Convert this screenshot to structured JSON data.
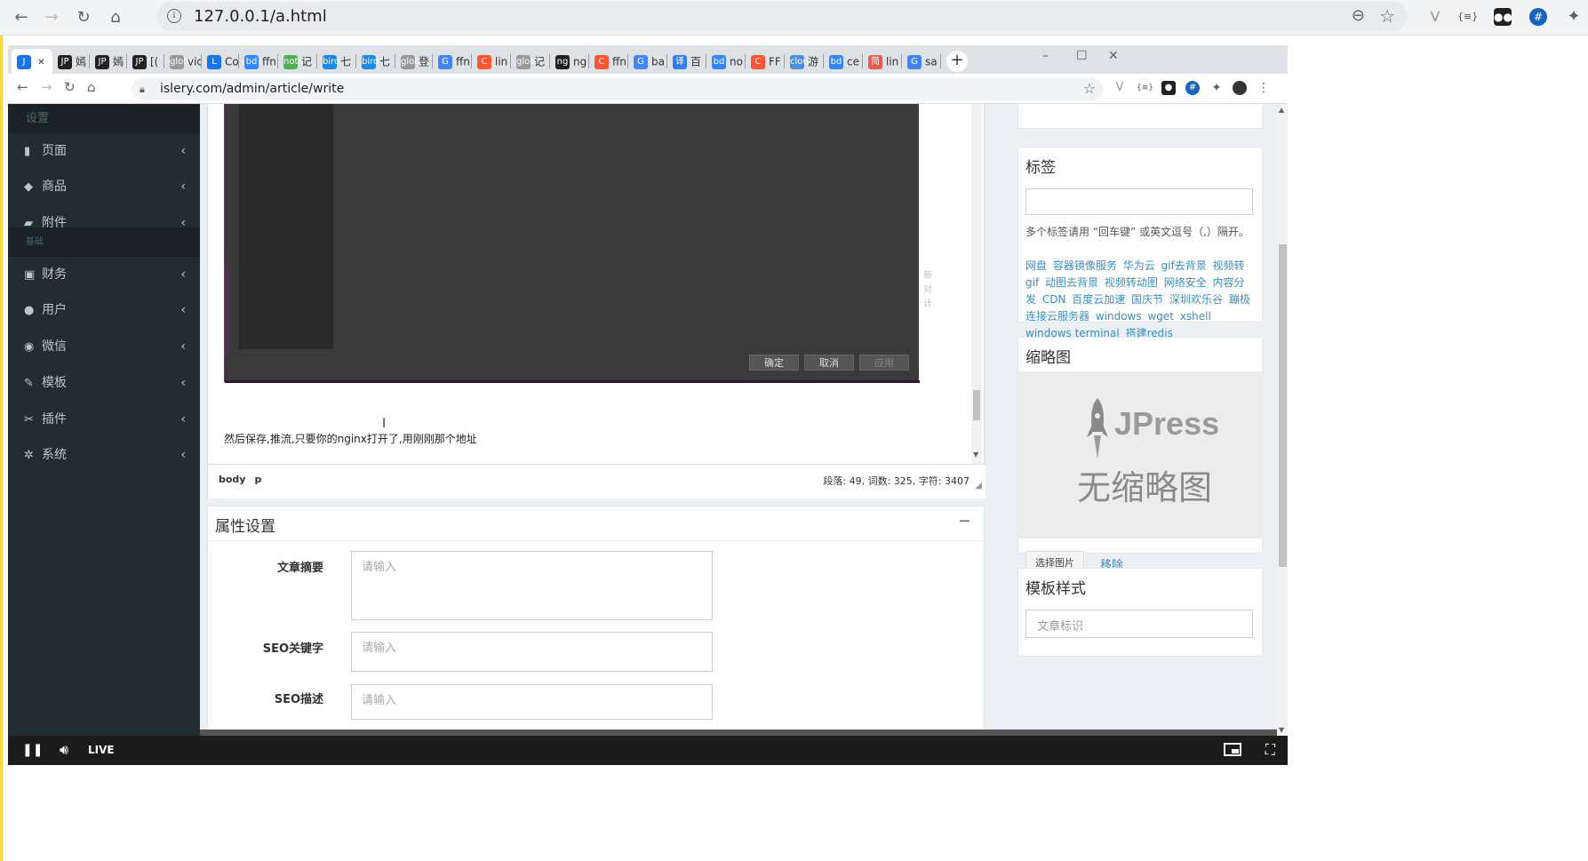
{
  "outer_browser": {
    "url": "127.0.0.1/a.html"
  },
  "inner_browser": {
    "tabs": [
      {
        "icon": "J",
        "label": "",
        "color": "#1a73e8",
        "active": true
      },
      {
        "icon": "JP",
        "label": "嫣",
        "color": "#222"
      },
      {
        "icon": "JP",
        "label": "嫣",
        "color": "#222"
      },
      {
        "icon": "JP",
        "label": "[(",
        "color": "#222"
      },
      {
        "icon": "globe",
        "label": "vic",
        "color": "#999"
      },
      {
        "icon": "L",
        "label": "Co",
        "color": "#1a73e8"
      },
      {
        "icon": "bd",
        "label": "ffn",
        "color": "#3385ff"
      },
      {
        "icon": "note",
        "label": "记",
        "color": "#4caf50"
      },
      {
        "icon": "bird",
        "label": "七",
        "color": "#1e88e5"
      },
      {
        "icon": "bird",
        "label": "七",
        "color": "#1e88e5"
      },
      {
        "icon": "globe",
        "label": "登",
        "color": "#999"
      },
      {
        "icon": "G",
        "label": "ffn",
        "color": "#4285f4"
      },
      {
        "icon": "C",
        "label": "lin",
        "color": "#fc5531"
      },
      {
        "icon": "globe",
        "label": "记",
        "color": "#999"
      },
      {
        "icon": "ng",
        "label": "ng",
        "color": "#222"
      },
      {
        "icon": "C",
        "label": "ffn",
        "color": "#fc5531"
      },
      {
        "icon": "G",
        "label": "ba",
        "color": "#4285f4"
      },
      {
        "icon": "译",
        "label": "百",
        "color": "#2e7cf6"
      },
      {
        "icon": "bd",
        "label": "no",
        "color": "#3385ff"
      },
      {
        "icon": "C",
        "label": "FF",
        "color": "#fc5531"
      },
      {
        "icon": "cloud",
        "label": "游",
        "color": "#4a90d9"
      },
      {
        "icon": "bd",
        "label": "ce",
        "color": "#3385ff"
      },
      {
        "icon": "简",
        "label": "lin",
        "color": "#e65c4f"
      },
      {
        "icon": "G",
        "label": "sa",
        "color": "#4285f4"
      }
    ],
    "url": "islery.com/admin/article/write"
  },
  "sidebar": {
    "header_settings": "设置",
    "header_basic": "基础",
    "items": [
      {
        "icon": "file-icon",
        "glyph": "▮",
        "label": "页面"
      },
      {
        "icon": "tag-icon",
        "glyph": "◆",
        "label": "商品"
      },
      {
        "icon": "folder-icon",
        "glyph": "▰",
        "label": "附件"
      },
      {
        "icon": "money-icon",
        "glyph": "▣",
        "label": "财务"
      },
      {
        "icon": "user-icon",
        "glyph": "●",
        "label": "用户"
      },
      {
        "icon": "wechat-icon",
        "glyph": "◉",
        "label": "微信"
      },
      {
        "icon": "wand-icon",
        "glyph": "✎",
        "label": "模板"
      },
      {
        "icon": "plug-icon",
        "glyph": "✂",
        "label": "插件"
      },
      {
        "icon": "cog-icon",
        "glyph": "✲",
        "label": "系统"
      }
    ]
  },
  "editor": {
    "embedded_buttons": {
      "ok": "确定",
      "cancel": "取消",
      "apply": "应用"
    },
    "body_text": "然后保存,推流,只要你的nginx打开了,用刚刚那个地址",
    "status_path": [
      "body",
      "p"
    ],
    "status_count": "段落: 49, 词数: 325, 字符: 3407"
  },
  "properties": {
    "title": "属性设置",
    "collapse": "−",
    "summary_label": "文章摘要",
    "summary_placeholder": "请输入",
    "seo_keywords_label": "SEO关键字",
    "seo_keywords_placeholder": "请输入",
    "seo_desc_label": "SEO描述",
    "seo_desc_placeholder": "请输入"
  },
  "tags_panel": {
    "title": "标签",
    "help": "多个标签请用 “回车键” 或英文逗号（,）隔开。",
    "tags": [
      "网盘",
      "容器镜像服务",
      "华为云",
      "gif去背景",
      "视频转gif",
      "动图去背景",
      "视频转动图",
      "网络安全",
      "内容分发",
      "CDN",
      "百度云加速",
      "国庆节",
      "深圳欢乐谷",
      "蹦极",
      "连接云服务器",
      "windows",
      "wget",
      "xshell",
      "windows terminal",
      "搭建redis"
    ]
  },
  "thumbnail_panel": {
    "title": "缩略图",
    "logo_text": "JPress",
    "no_thumb_text": "无缩略图",
    "pick_button": "选择图片",
    "remove_link": "移除"
  },
  "template_panel": {
    "title": "模板样式",
    "placeholder": "文章标识"
  },
  "video_controls": {
    "live_label": "LIVE"
  }
}
